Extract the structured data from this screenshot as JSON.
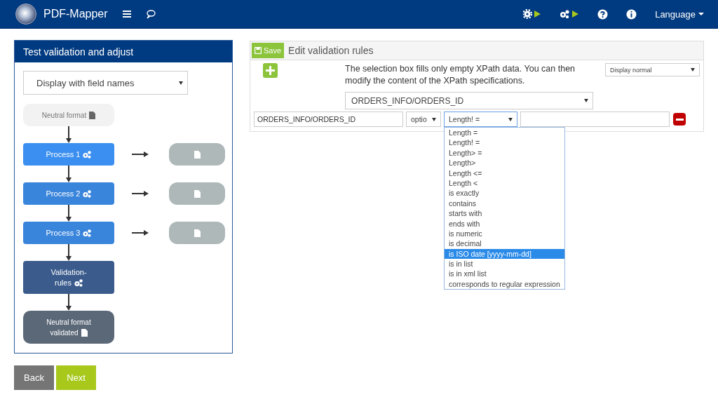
{
  "navbar": {
    "brand": "PDF-Mapper",
    "language": "Language"
  },
  "left_panel": {
    "title": "Test validation and adjust",
    "display_select": "Display with field names",
    "flow": [
      {
        "kind": "source",
        "lines": [
          "Neutral format"
        ],
        "output": false
      },
      {
        "kind": "process",
        "lines": [
          "Process 1"
        ],
        "output": true
      },
      {
        "kind": "process2",
        "lines": [
          "Process 2"
        ],
        "output": true
      },
      {
        "kind": "process2",
        "lines": [
          "Process 3"
        ],
        "output": true
      },
      {
        "kind": "rules",
        "lines": [
          "Validation-",
          "rules"
        ],
        "output": false
      },
      {
        "kind": "result",
        "lines": [
          "Neutral format",
          "validated"
        ],
        "output": false
      }
    ]
  },
  "buttons": [
    {
      "kind": "back",
      "label": "Back"
    },
    {
      "kind": "next",
      "label": "Next"
    }
  ],
  "editor": {
    "save_label": "Save",
    "title": "Edit validation rules",
    "hint": "The selection box fills only empty XPath data. You can then modify the content of the XPath specifications.",
    "display_select": "Display normal",
    "xpath_select": "ORDERS_INFO/ORDERS_ID",
    "rule": {
      "path": "ORDERS_INFO/ORDERS_ID",
      "option_select": "optio",
      "operator_select": "Length! =",
      "expanded": true,
      "options": [
        {
          "label": "Length =",
          "selected": false
        },
        {
          "label": "Length! =",
          "selected": false
        },
        {
          "label": "Length> =",
          "selected": false
        },
        {
          "label": "Length>",
          "selected": false
        },
        {
          "label": "Length <=",
          "selected": false
        },
        {
          "label": "Length <",
          "selected": false
        },
        {
          "label": "is exactly",
          "selected": false
        },
        {
          "label": "contains",
          "selected": false
        },
        {
          "label": "starts with",
          "selected": false
        },
        {
          "label": "ends with",
          "selected": false
        },
        {
          "label": "is numeric",
          "selected": false
        },
        {
          "label": "is decimal",
          "selected": false
        },
        {
          "label": "is ISO date [yyyy-mm-dd]",
          "selected": true
        },
        {
          "label": "is in list",
          "selected": false
        },
        {
          "label": "is in xml list",
          "selected": false
        },
        {
          "label": "corresponds to regular expression",
          "selected": false
        }
      ]
    }
  }
}
